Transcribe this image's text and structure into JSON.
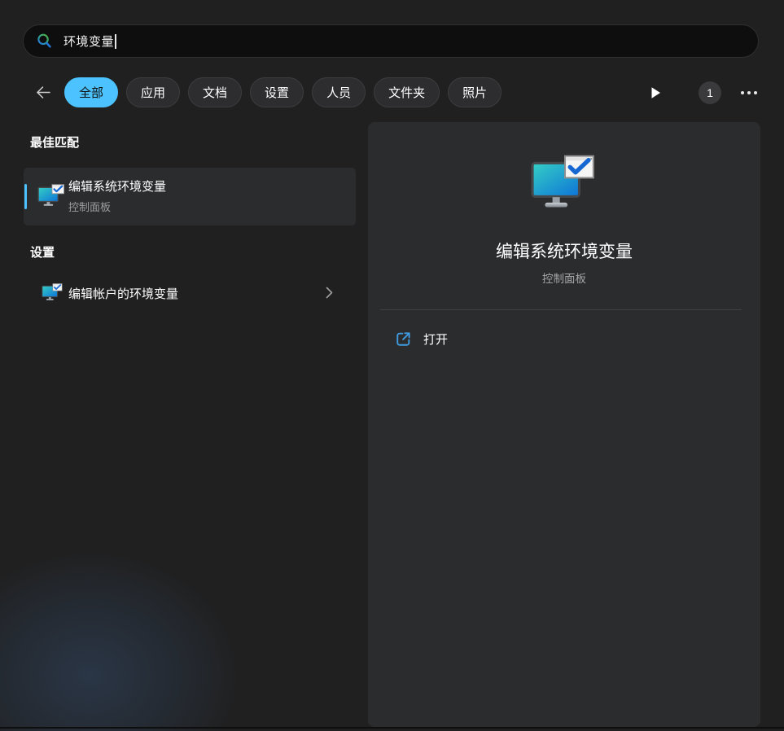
{
  "search": {
    "value": "环境变量"
  },
  "toolbar": {
    "tabs": [
      {
        "label": "全部",
        "active": true
      },
      {
        "label": "应用",
        "active": false
      },
      {
        "label": "文档",
        "active": false
      },
      {
        "label": "设置",
        "active": false
      },
      {
        "label": "人员",
        "active": false
      },
      {
        "label": "文件夹",
        "active": false
      },
      {
        "label": "照片",
        "active": false
      }
    ],
    "result_count": "1"
  },
  "results": {
    "best_match_header": "最佳匹配",
    "best_match": {
      "title": "编辑系统环境变量",
      "subtitle": "控制面板"
    },
    "settings_header": "设置",
    "settings_item": {
      "title": "编辑帐户的环境变量"
    }
  },
  "preview": {
    "title": "编辑系统环境变量",
    "subtitle": "控制面板",
    "open_label": "打开"
  },
  "colors": {
    "accent": "#4cc2ff",
    "background": "#202020",
    "panel": "#2b2c2e",
    "search_icon_green": "#4bb04c",
    "search_icon_blue": "#2479dd",
    "monitor_cyan": "#35cfc4",
    "monitor_blue": "#0f78d7",
    "check_blue": "#1767d2",
    "open_icon_blue": "#3f9ce0"
  }
}
